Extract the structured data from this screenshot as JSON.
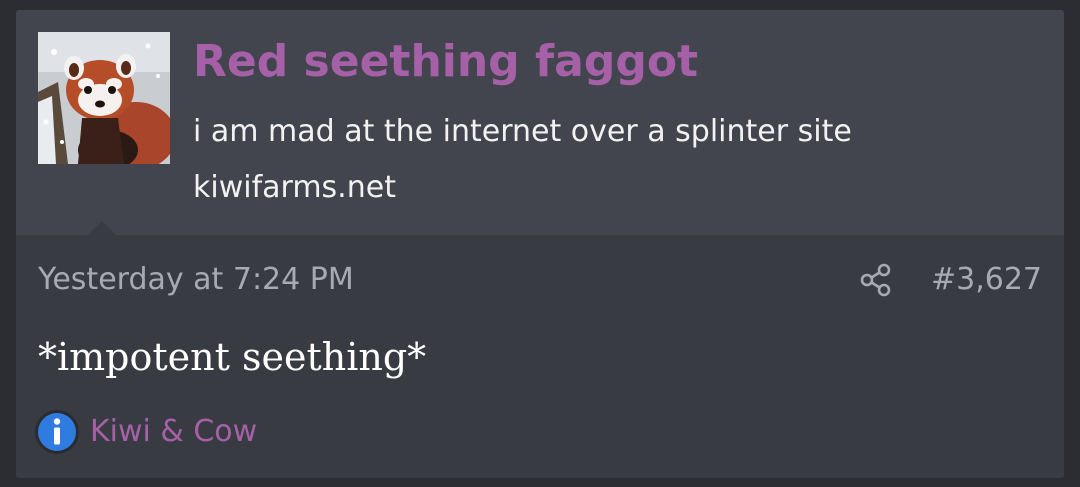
{
  "user": {
    "name": "Red seething faggot",
    "title": "i am mad at the internet over a splinter site",
    "extra": "kiwifarms.net"
  },
  "post": {
    "date": "Yesterday at 7:24 PM",
    "number": "#3,627",
    "body": "*impotent seething*"
  },
  "reactions": {
    "label": "Kiwi & Cow"
  },
  "colors": {
    "background": "#2b2d33",
    "card": "#383b42",
    "header": "#42454d",
    "username": "#a660a8",
    "meta_text": "#a7aab0",
    "info_icon": "#2f7be0"
  },
  "icons": {
    "share": "share-icon",
    "reaction": "info-icon"
  }
}
